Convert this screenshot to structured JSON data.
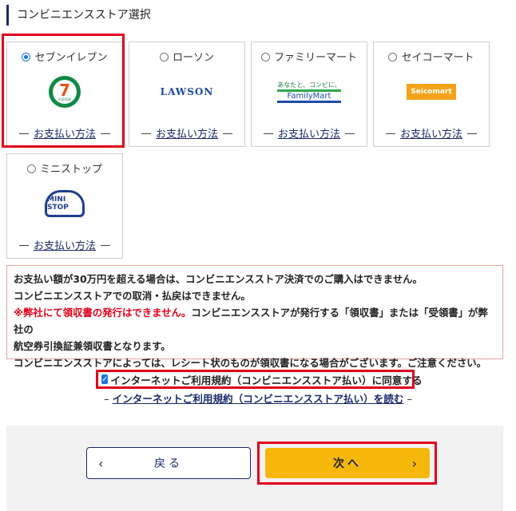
{
  "section": {
    "title": "コンビニエンスストア選択"
  },
  "stores": [
    {
      "label": "セブンイレブン",
      "selected": true,
      "pay": "お支払い方法",
      "logo": "7-eleven-logo",
      "logo_text": "ELEVEN"
    },
    {
      "label": "ローソン",
      "selected": false,
      "pay": "お支払い方法",
      "logo": "lawson-logo",
      "logo_text": "LAWSON"
    },
    {
      "label": "ファミリーマート",
      "selected": false,
      "pay": "お支払い方法",
      "logo": "familymart-logo",
      "logo_text": "FamilyMart",
      "logo_tagline": "あなたと、コンビに、"
    },
    {
      "label": "セイコーマート",
      "selected": false,
      "pay": "お支払い方法",
      "logo": "seicomart-logo",
      "logo_text": "Seicomart"
    },
    {
      "label": "ミニストップ",
      "selected": false,
      "pay": "お支払い方法",
      "logo": "ministop-logo",
      "logo_text": "MINI STOP"
    }
  ],
  "notice": {
    "line1": "お支払い額が30万円を超える場合は、コンビニエンスストア決済でのご購入はできません。",
    "line2": "コンビニエンスストアでの取消・払戻はできません。",
    "line3_red": "※弊社にて領収書の発行はできません。",
    "line3_rest": "コンビニエンスストアが発行する「領収書」または「受領書」が弊社の",
    "line4": "航空券引換証兼領収書となります。",
    "line5": "コンビニエンスストアによっては、レシート状のものが領収書になる場合がございます。ご注意ください。"
  },
  "agree": {
    "label": "インターネットご利用規約（コンビニエンスストア払い）に同意する",
    "checked": true
  },
  "terms": {
    "link": "インターネットご利用規約（コンビニエンスストア払い）を読む"
  },
  "buttons": {
    "back": "戻る",
    "next": "次へ"
  },
  "colors": {
    "accent": "#1a73e8",
    "highlight": "#e0001b",
    "next_button": "#f5b70a",
    "navy": "#1b2a6b"
  }
}
